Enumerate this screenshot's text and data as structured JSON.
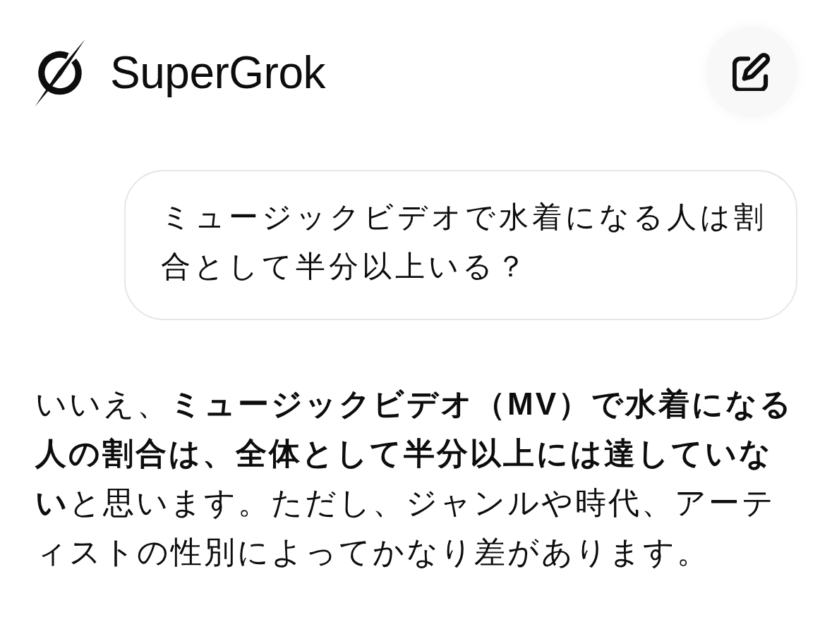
{
  "header": {
    "brand": "SuperGrok"
  },
  "messages": [
    {
      "kind": "user",
      "text": "ミュージックビデオで水着になる人は割合として半分以上いる？"
    },
    {
      "kind": "assistant",
      "text": "いいえ、**ミュージックビデオ（MV）で水着になる人の割合は、全体として半分以上には達していない**と思います。ただし、ジャンルや時代、アーティストの性別によってかなり差があります。"
    }
  ]
}
